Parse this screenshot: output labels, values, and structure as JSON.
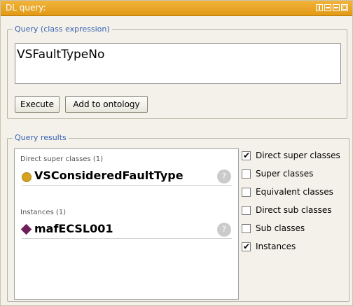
{
  "window": {
    "title": "DL query:"
  },
  "query": {
    "group_label": "Query (class expression)",
    "expression": "VSFaultTypeNo",
    "execute_label": "Execute",
    "add_label": "Add to ontology"
  },
  "results": {
    "group_label": "Query results",
    "direct_super_label": "Direct super classes (1)",
    "direct_super_item": "VSConsideredFaultType",
    "instances_label": "Instances (1)",
    "instance_item": "mafECSL001",
    "help_glyph": "?"
  },
  "options": [
    {
      "label": "Direct super classes",
      "checked": true
    },
    {
      "label": "Super classes",
      "checked": false
    },
    {
      "label": "Equivalent classes",
      "checked": false
    },
    {
      "label": "Direct sub classes",
      "checked": false
    },
    {
      "label": "Sub classes",
      "checked": false
    },
    {
      "label": "Instances",
      "checked": true
    }
  ],
  "colors": {
    "titlebar": "#e8a526",
    "group_label": "#3a62b5",
    "class_icon": "#d7a31f",
    "individual_icon": "#6e1f5a"
  }
}
